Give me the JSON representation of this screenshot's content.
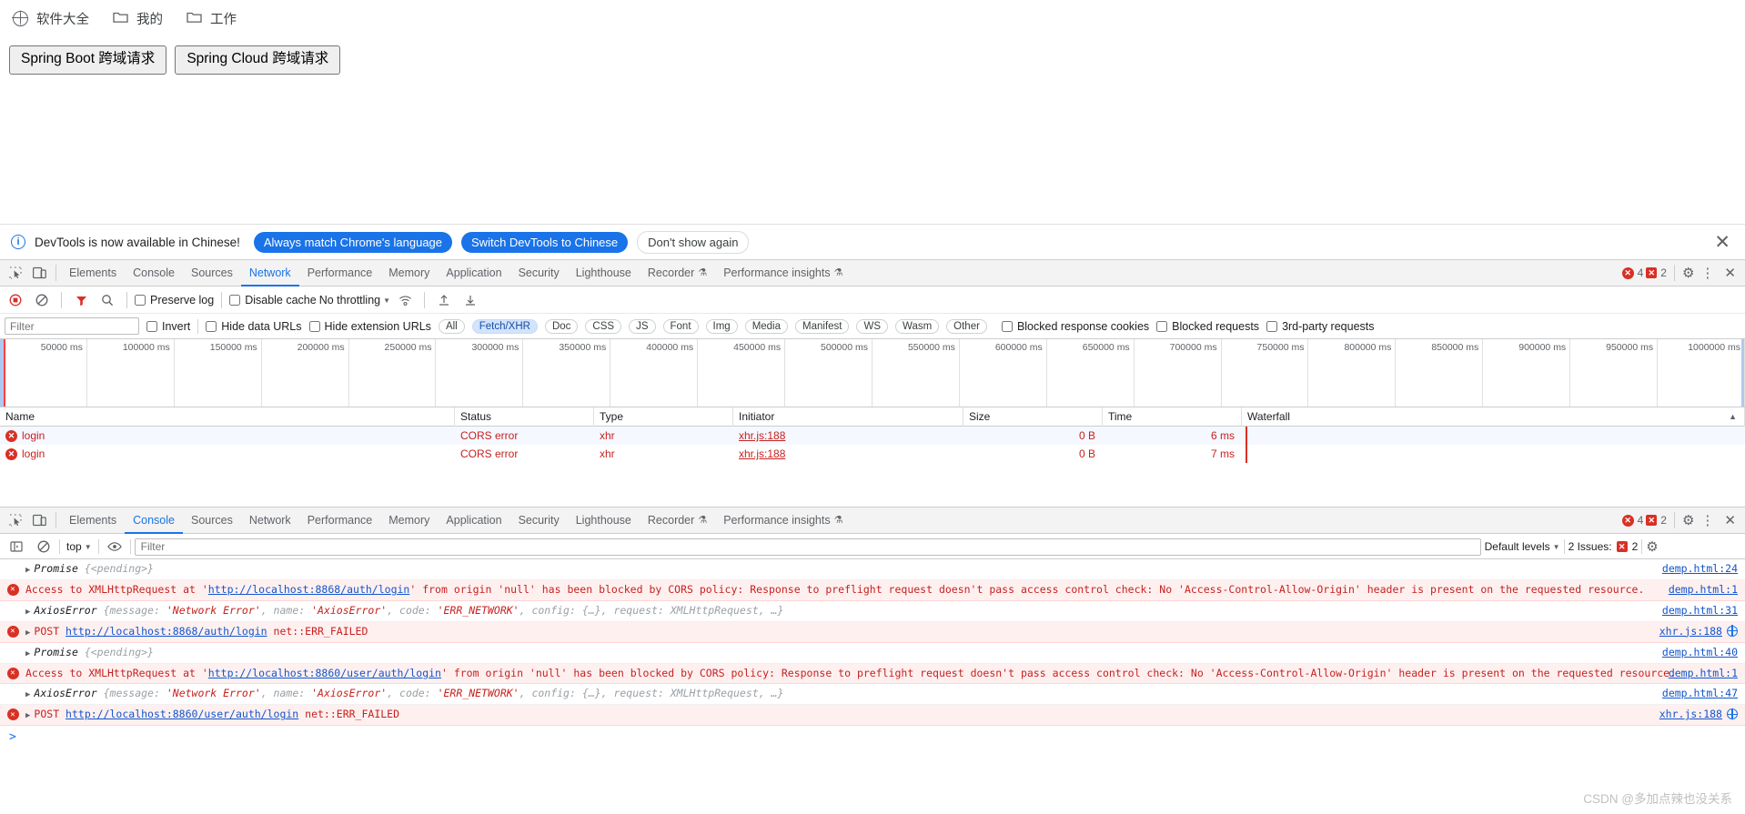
{
  "browser": {
    "bookmarks": [
      {
        "label": "软件大全",
        "icon": "globe-icon"
      },
      {
        "label": "我的",
        "icon": "folder-icon"
      },
      {
        "label": "工作",
        "icon": "folder-icon"
      }
    ]
  },
  "page": {
    "buttons": [
      {
        "label": "Spring Boot 跨域请求"
      },
      {
        "label": "Spring Cloud 跨域请求"
      }
    ]
  },
  "notice": {
    "icon": "info-icon",
    "text": "DevTools is now available in Chinese!",
    "primary_button": "Always match Chrome's language",
    "secondary_button": "Switch DevTools to Chinese",
    "dismiss_button": "Don't show again",
    "close_icon": "close-icon",
    "accent_color": "#1a73e8"
  },
  "network_panel": {
    "tabs": [
      {
        "label": "Elements",
        "active": false
      },
      {
        "label": "Console",
        "active": false
      },
      {
        "label": "Sources",
        "active": false
      },
      {
        "label": "Network",
        "active": true
      },
      {
        "label": "Performance",
        "active": false
      },
      {
        "label": "Memory",
        "active": false
      },
      {
        "label": "Application",
        "active": false
      },
      {
        "label": "Security",
        "active": false
      },
      {
        "label": "Lighthouse",
        "active": false
      },
      {
        "label": "Recorder",
        "active": false,
        "badge": "experiment-flask-icon"
      },
      {
        "label": "Performance insights",
        "active": false,
        "badge": "experiment-flask-icon"
      }
    ],
    "error_count": "4",
    "warning_count": "2",
    "toolbar": {
      "record_icon": "record-stop-icon",
      "clear_icon": "clear-icon",
      "filter_icon": "filter-funnel-icon",
      "search_icon": "search-icon",
      "preserve_log": "Preserve log",
      "disable_cache": "Disable cache",
      "throttling": "No throttling",
      "network_conditions_icon": "wifi-icon",
      "import_har_icon": "upload-icon",
      "export_har_icon": "download-icon"
    },
    "filterbar": {
      "filter_placeholder": "Filter",
      "filter_value": "",
      "invert": "Invert",
      "hide_data_urls": "Hide data URLs",
      "hide_extension_urls": "Hide extension URLs",
      "types": [
        {
          "label": "All",
          "active": false
        },
        {
          "label": "Fetch/XHR",
          "active": true
        },
        {
          "label": "Doc",
          "active": false
        },
        {
          "label": "CSS",
          "active": false
        },
        {
          "label": "JS",
          "active": false
        },
        {
          "label": "Font",
          "active": false
        },
        {
          "label": "Img",
          "active": false
        },
        {
          "label": "Media",
          "active": false
        },
        {
          "label": "Manifest",
          "active": false
        },
        {
          "label": "WS",
          "active": false
        },
        {
          "label": "Wasm",
          "active": false
        },
        {
          "label": "Other",
          "active": false
        }
      ],
      "blocked_response_cookies": "Blocked response cookies",
      "blocked_requests": "Blocked requests",
      "third_party_requests": "3rd-party requests"
    },
    "overview_ticks": [
      "50000 ms",
      "100000 ms",
      "150000 ms",
      "200000 ms",
      "250000 ms",
      "300000 ms",
      "350000 ms",
      "400000 ms",
      "450000 ms",
      "500000 ms",
      "550000 ms",
      "600000 ms",
      "650000 ms",
      "700000 ms",
      "750000 ms",
      "800000 ms",
      "850000 ms",
      "900000 ms",
      "950000 ms",
      "1000000 ms"
    ],
    "table": {
      "columns": [
        "Name",
        "Status",
        "Type",
        "Initiator",
        "Size",
        "Time",
        "Waterfall"
      ],
      "rows": [
        {
          "icon": "error-circle-icon",
          "name": "login",
          "status": "CORS error",
          "type": "xhr",
          "initiator": "xhr.js:188",
          "size": "0 B",
          "time": "6 ms"
        },
        {
          "icon": "error-circle-icon",
          "name": "login",
          "status": "CORS error",
          "type": "xhr",
          "initiator": "xhr.js:188",
          "size": "0 B",
          "time": "7 ms"
        }
      ]
    }
  },
  "console_panel": {
    "tabs": [
      {
        "label": "Elements",
        "active": false
      },
      {
        "label": "Console",
        "active": true
      },
      {
        "label": "Sources",
        "active": false
      },
      {
        "label": "Network",
        "active": false
      },
      {
        "label": "Performance",
        "active": false
      },
      {
        "label": "Memory",
        "active": false
      },
      {
        "label": "Application",
        "active": false
      },
      {
        "label": "Security",
        "active": false
      },
      {
        "label": "Lighthouse",
        "active": false
      },
      {
        "label": "Recorder",
        "active": false
      },
      {
        "label": "Performance insights",
        "active": false
      }
    ],
    "error_count": "4",
    "warning_count": "2",
    "toolbar": {
      "sidebar_icon": "sidebar-toggle-icon",
      "clear_icon": "clear-console-icon",
      "context": "top",
      "eye_icon": "live-expression-icon",
      "filter_placeholder": "Filter",
      "filter_value": "",
      "levels": "Default levels",
      "issues_label": "2 Issues:",
      "issues_count": "2",
      "settings_icon": "gear-icon"
    },
    "messages": [
      {
        "kind": "log",
        "expandable": true,
        "obj": "Promise",
        "detail": "{<pending>}",
        "source": "demp.html:24"
      },
      {
        "kind": "error",
        "expandable": false,
        "pre": "Access to XMLHttpRequest at '",
        "link": "http://localhost:8868/auth/login",
        "post": "' from origin 'null' has been blocked by CORS policy: Response to preflight request doesn't pass access control check: No 'Access-Control-Allow-Origin' header is present on the requested resource.",
        "source": "demp.html:1"
      },
      {
        "kind": "log",
        "expandable": true,
        "obj": "AxiosError",
        "detail_parts": [
          {
            "t": "{message: ",
            "c": "dim"
          },
          {
            "t": "'Network Error'",
            "c": "str"
          },
          {
            "t": ", name: ",
            "c": "dim"
          },
          {
            "t": "'AxiosError'",
            "c": "str"
          },
          {
            "t": ", code: ",
            "c": "dim"
          },
          {
            "t": "'ERR_NETWORK'",
            "c": "str"
          },
          {
            "t": ", config: {…}, request: XMLHttpRequest, …}",
            "c": "dim"
          }
        ],
        "source": "demp.html:31"
      },
      {
        "kind": "error",
        "expandable": true,
        "method": "POST",
        "link": "http://localhost:8868/auth/login",
        "post": " net::ERR_FAILED",
        "source": "xhr.js:188",
        "source_icon": "globe-icon"
      },
      {
        "kind": "log",
        "expandable": true,
        "obj": "Promise",
        "detail": "{<pending>}",
        "source": "demp.html:40"
      },
      {
        "kind": "error",
        "expandable": false,
        "pre": "Access to XMLHttpRequest at '",
        "link": "http://localhost:8860/user/auth/login",
        "post": "' from origin 'null' has been blocked by CORS policy: Response to preflight request doesn't pass access control check: No 'Access-Control-Allow-Origin' header is present on the requested resource.",
        "source": "demp.html:1"
      },
      {
        "kind": "log",
        "expandable": true,
        "obj": "AxiosError",
        "detail_parts": [
          {
            "t": "{message: ",
            "c": "dim"
          },
          {
            "t": "'Network Error'",
            "c": "str"
          },
          {
            "t": ", name: ",
            "c": "dim"
          },
          {
            "t": "'AxiosError'",
            "c": "str"
          },
          {
            "t": ", code: ",
            "c": "dim"
          },
          {
            "t": "'ERR_NETWORK'",
            "c": "str"
          },
          {
            "t": ", config: {…}, request: XMLHttpRequest, …}",
            "c": "dim"
          }
        ],
        "source": "demp.html:47"
      },
      {
        "kind": "error",
        "expandable": true,
        "method": "POST",
        "link": "http://localhost:8860/user/auth/login",
        "post": " net::ERR_FAILED",
        "source": "xhr.js:188",
        "source_icon": "globe-icon"
      }
    ],
    "prompt": ">"
  },
  "watermark": "CSDN @多加点辣也没关系"
}
